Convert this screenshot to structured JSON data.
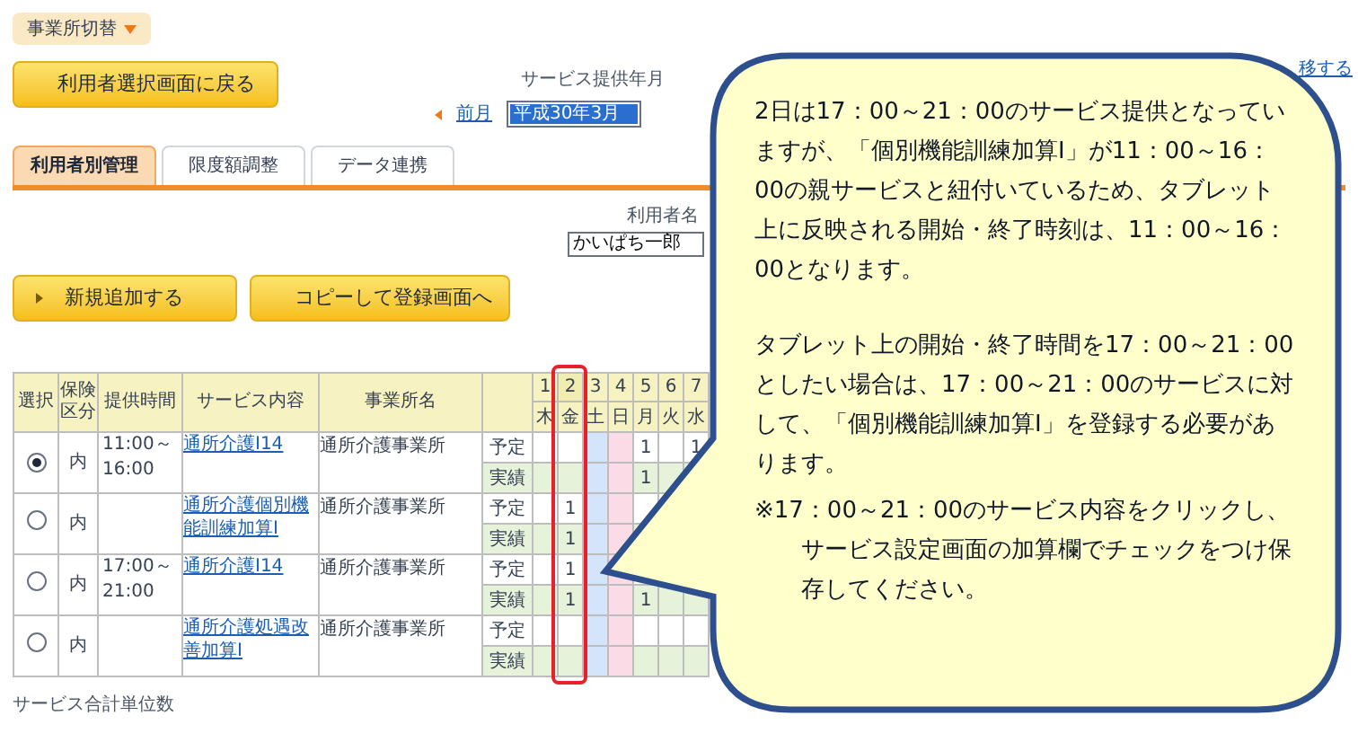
{
  "office_switch": "事業所切替",
  "back_button": "利用者選択画面に戻る",
  "period": {
    "label": "サービス提供年月",
    "prev_link": "前月",
    "month": "平成30年3月",
    "transition_link": "移する"
  },
  "tabs": [
    {
      "label": "利用者別管理",
      "selected": true
    },
    {
      "label": "限度額調整",
      "selected": false
    },
    {
      "label": "データ連携",
      "selected": false
    }
  ],
  "user": {
    "label": "利用者名",
    "value": "かいぱち一郎"
  },
  "action_buttons": [
    "新規追加する",
    "コピーして登録画面へ"
  ],
  "table": {
    "columns": [
      "選択",
      "保険区分",
      "提供時間",
      "サービス内容",
      "事業所名"
    ],
    "days": [
      {
        "date": "1",
        "weekday": "木",
        "kind": "weekday",
        "highlighted": false
      },
      {
        "date": "2",
        "weekday": "金",
        "kind": "weekday",
        "highlighted": true
      },
      {
        "date": "3",
        "weekday": "土",
        "kind": "saturday",
        "highlighted": false
      },
      {
        "date": "4",
        "weekday": "日",
        "kind": "sunday",
        "highlighted": false
      },
      {
        "date": "5",
        "weekday": "月",
        "kind": "weekday",
        "highlighted": false
      },
      {
        "date": "6",
        "weekday": "火",
        "kind": "weekday",
        "highlighted": false
      },
      {
        "date": "7",
        "weekday": "水",
        "kind": "weekday",
        "highlighted": false
      }
    ],
    "rows": [
      {
        "selected": true,
        "insurance": "内",
        "time": "11:00～16:00",
        "service": "通所介護Ⅰ14",
        "office": "通所介護事業所",
        "lines": [
          {
            "label": "予定",
            "kind": "plan",
            "cells": [
              {},
              {},
              {},
              {},
              {
                "value": "1"
              },
              {},
              {
                "value": "1"
              }
            ]
          },
          {
            "label": "実績",
            "kind": "actual",
            "cells": [
              {},
              {},
              {},
              {},
              {
                "value": "1"
              },
              {},
              {}
            ]
          }
        ]
      },
      {
        "selected": false,
        "insurance": "内",
        "service": "通所介護個別機能訓練加算Ⅰ",
        "office": "通所介護事業所",
        "lines": [
          {
            "label": "予定",
            "kind": "plan",
            "cells": [
              {},
              {
                "value": "1"
              },
              {},
              {},
              {},
              {},
              {}
            ]
          },
          {
            "label": "実績",
            "kind": "actual",
            "cells": [
              {},
              {
                "value": "1"
              },
              {},
              {},
              {},
              {},
              {}
            ]
          }
        ]
      },
      {
        "selected": false,
        "insurance": "内",
        "time": "17:00～21:00",
        "service": "通所介護Ⅰ14",
        "office": "通所介護事業所",
        "lines": [
          {
            "label": "予定",
            "kind": "plan",
            "cells": [
              {},
              {
                "value": "1"
              },
              {},
              {},
              {},
              {},
              {}
            ]
          },
          {
            "label": "実績",
            "kind": "actual",
            "cells": [
              {},
              {
                "value": "1"
              },
              {},
              {},
              {
                "value": "1"
              },
              {},
              {}
            ]
          }
        ]
      },
      {
        "selected": false,
        "insurance": "内",
        "service": "通所介護処遇改善加算Ⅰ",
        "office": "通所介護事業所",
        "lines": [
          {
            "label": "予定",
            "kind": "plan",
            "cells": [
              {},
              {},
              {},
              {},
              {},
              {},
              {}
            ]
          },
          {
            "label": "実績",
            "kind": "actual",
            "cells": [
              {},
              {},
              {},
              {},
              {},
              {},
              {}
            ]
          }
        ]
      }
    ]
  },
  "footer": "サービス合計単位数",
  "callout": {
    "paragraphs": [
      "2日は17：00～21：00のサービス提供となっていますが、「個別機能訓練加算Ⅰ」が11：00～16：00の親サービスと紐付いているため、タブレット上に反映される開始・終了時刻は、11：00～16：00となります。",
      "タブレット上の開始・終了時間を17：00～21：00としたい場合は、17：00～21：00のサービスに対して、「個別機能訓練加算Ⅰ」を登録する必要があります。"
    ],
    "note": "※17：00～21：00のサービス内容をクリックし、サービス設定画面の加算欄でチェックをつけ保存してください。"
  }
}
